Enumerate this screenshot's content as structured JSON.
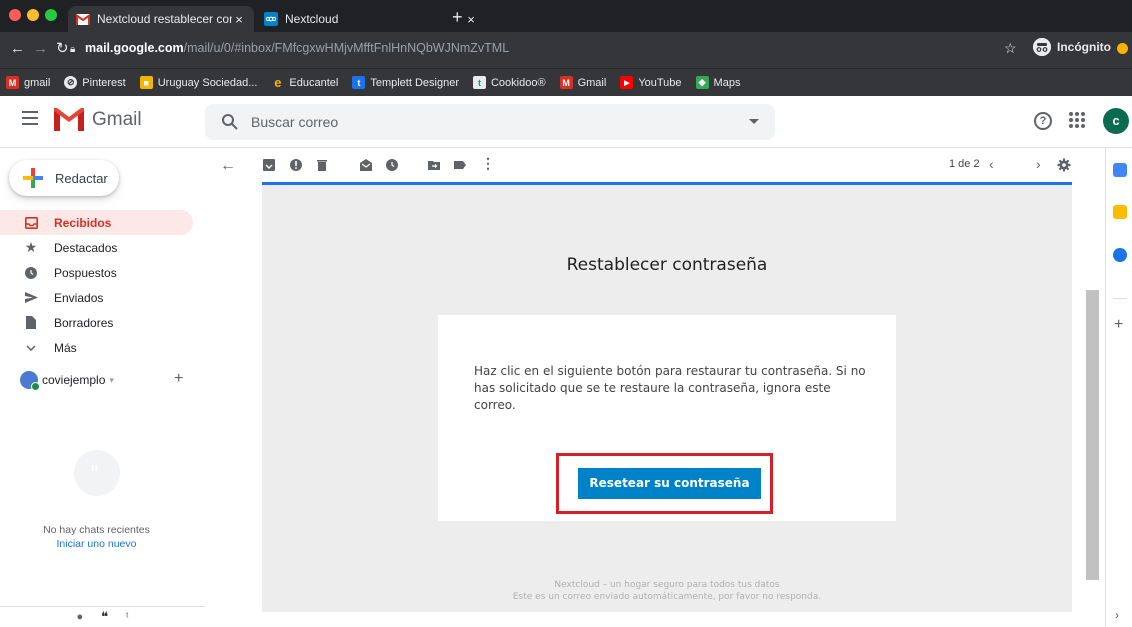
{
  "browser": {
    "tabs": [
      {
        "title": "Nextcloud restablecer contrase",
        "close": "×",
        "active": true
      },
      {
        "title": "Nextcloud",
        "close": "×",
        "active": false
      }
    ],
    "new_tab": "+",
    "url_host": "mail.google.com",
    "url_rest": "/mail/u/0/#inbox/FMfcgxwHMjvMfftFnlHnNQbWJNmZvTML",
    "incognito_label": "Incógnito",
    "bookmarks": [
      {
        "label": "gmail",
        "icon": "gmail-icon",
        "color": "#d93025"
      },
      {
        "label": "Pinterest",
        "icon": "pinterest-icon",
        "color": "#e60023"
      },
      {
        "label": "Uruguay Sociedad...",
        "icon": "folder-icon",
        "color": "#f4b400"
      },
      {
        "label": "Educantel",
        "icon": "educantel-icon",
        "color": "#f4b400"
      },
      {
        "label": "Templett Designer",
        "icon": "templett-icon",
        "color": "#1a73e8"
      },
      {
        "label": "Cookidoo®",
        "icon": "cookidoo-icon",
        "color": "#0f9d58"
      },
      {
        "label": "Gmail",
        "icon": "gmail-icon",
        "color": "#d93025"
      },
      {
        "label": "YouTube",
        "icon": "youtube-icon",
        "color": "#ff0000"
      },
      {
        "label": "Maps",
        "icon": "maps-icon",
        "color": "#34a853"
      }
    ]
  },
  "gmail": {
    "wordmark": "Gmail",
    "search_placeholder": "Buscar correo",
    "help": "?",
    "avatar_letter": "c",
    "compose_label": "Redactar",
    "nav": [
      {
        "label": "Recibidos",
        "icon": "inbox-icon",
        "active": true
      },
      {
        "label": "Destacados",
        "icon": "star-icon",
        "active": false
      },
      {
        "label": "Pospuestos",
        "icon": "clock-icon",
        "active": false
      },
      {
        "label": "Enviados",
        "icon": "send-icon",
        "active": false
      },
      {
        "label": "Borradores",
        "icon": "draft-icon",
        "active": false
      },
      {
        "label": "Más",
        "icon": "chevron-down-icon",
        "active": false
      }
    ],
    "account_name": "coviejemplo",
    "chats_empty": "No hay chats recientes",
    "chats_start": "Iniciar uno nuevo",
    "pager": "1 de 2"
  },
  "email": {
    "title": "Restablecer contraseña",
    "body": "Haz clic en el siguiente botón para restaurar tu contraseña. Si no has solicitado que se te restaure la contraseña, ignora este correo.",
    "button_label": "Resetear su contraseña",
    "footer_line1": "Nextcloud – un hogar seguro para todos tus datos",
    "footer_line2": "Este es un correo enviado automáticamente, por favor no responda."
  },
  "colors": {
    "gmail_red": "#d93025",
    "nextcloud_blue": "#0082c9",
    "highlight_red": "#d42026",
    "link_blue": "#1a73e8"
  }
}
